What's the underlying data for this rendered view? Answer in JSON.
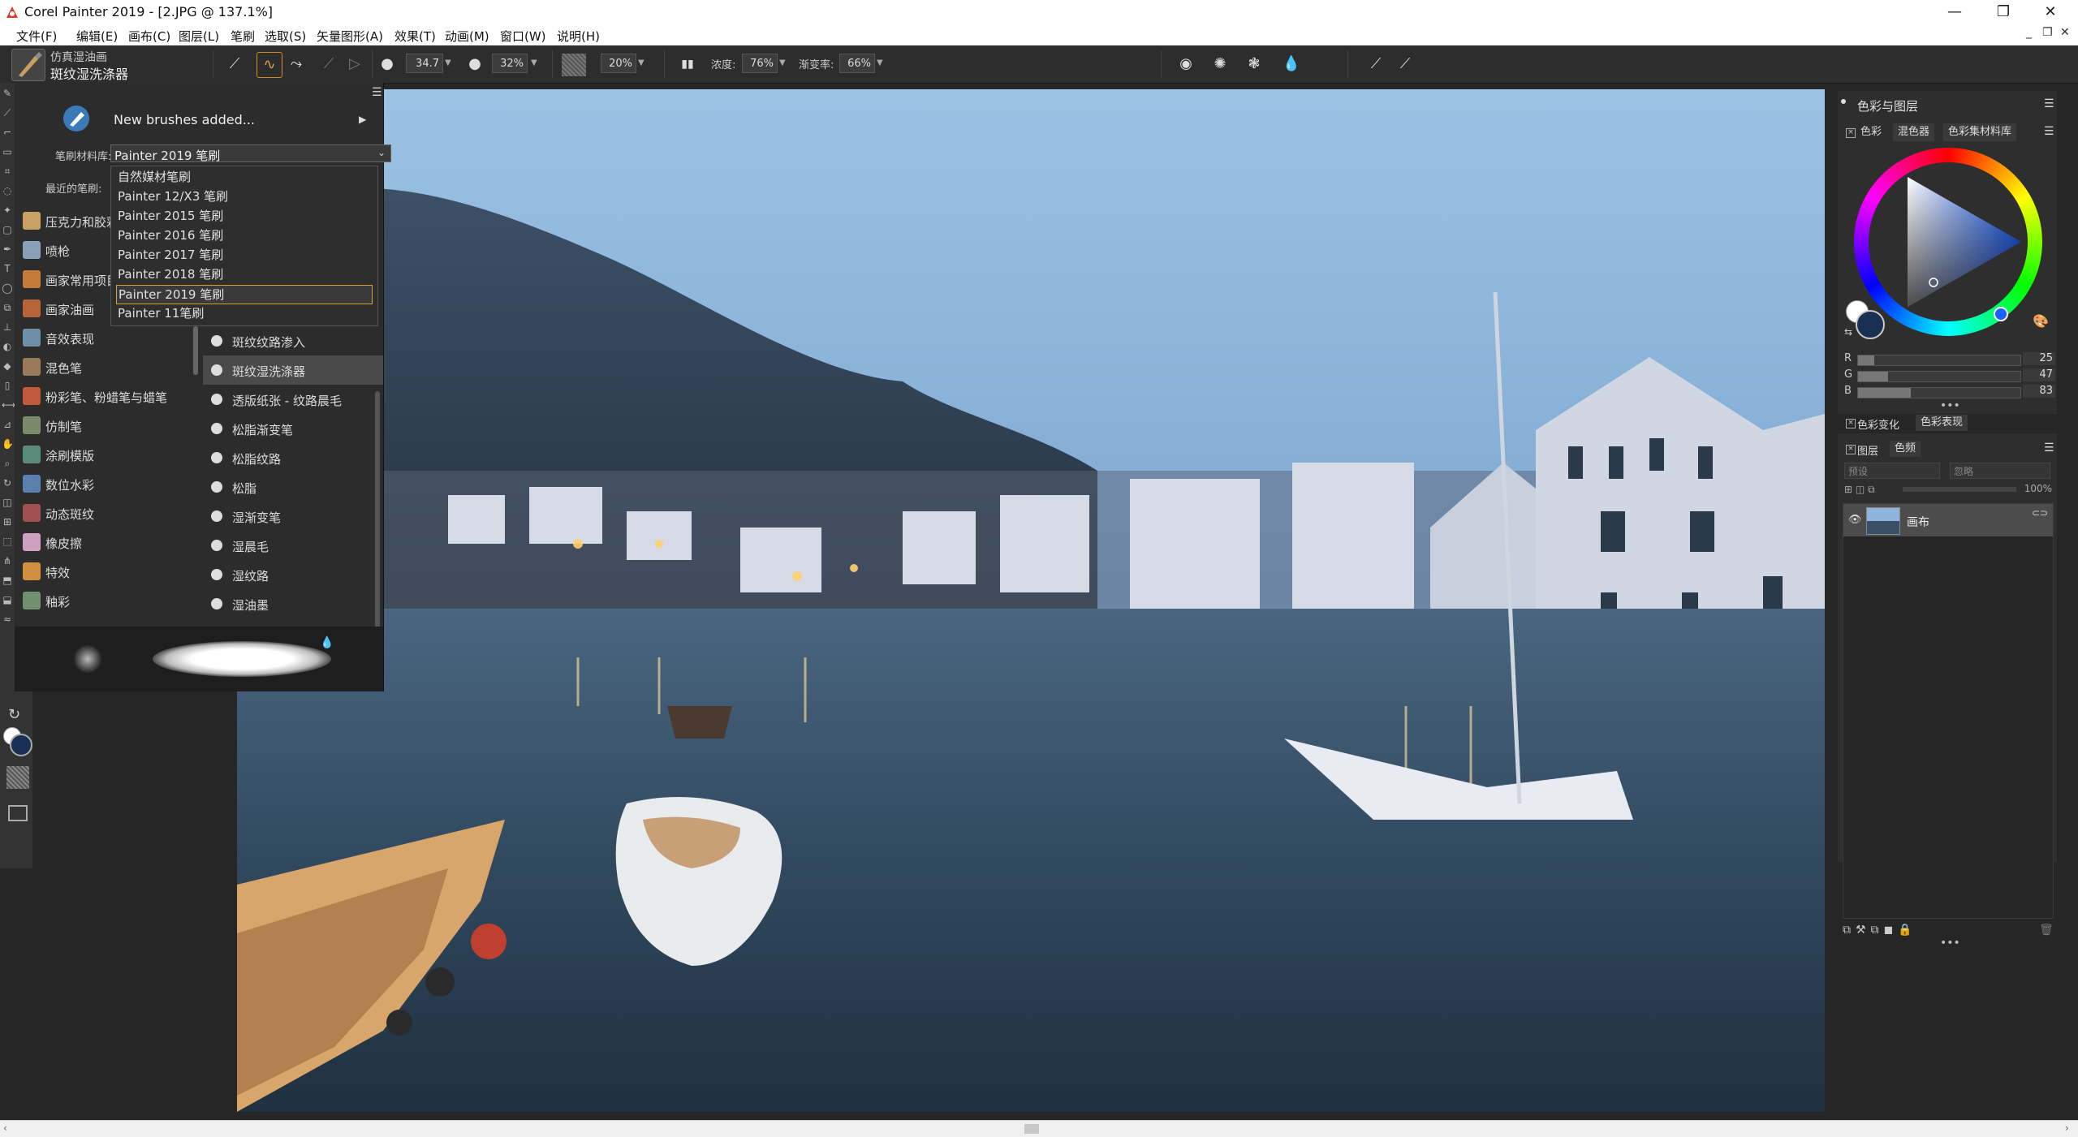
{
  "window": {
    "title": "Corel Painter 2019 - [2.JPG @ 137.1%]",
    "minimize": "—",
    "restore": "❐",
    "close": "✕",
    "mdi_min": "_",
    "mdi_restore": "❐",
    "mdi_close": "✕"
  },
  "menu": [
    "文件(F)",
    "编辑(E)",
    "画布(C)",
    "图层(L)",
    "笔刷",
    "选取(S)",
    "矢量图形(A)",
    "效果(T)",
    "动画(M)",
    "窗口(W)",
    "说明(H)"
  ],
  "brush": {
    "category": "仿真湿油画",
    "variant": "斑纹湿洗涤器"
  },
  "propbar": {
    "size_value": "34.7",
    "opacity_value": "32%",
    "grain_value": "20%",
    "density_label": "浓度:",
    "density_value": "76%",
    "blend_label": "渐变率:",
    "blend_value": "66%"
  },
  "brush_panel": {
    "new_brushes_text": "New brushes added...",
    "library_label": "笔刷材料库:",
    "library_value": "Painter 2019 笔刷",
    "recent_label": "最近的笔刷:",
    "library_options": [
      "自然媒材笔刷",
      "Painter 12/X3 笔刷",
      "Painter 2015 笔刷",
      "Painter 2016 笔刷",
      "Painter 2017 笔刷",
      "Painter 2018 笔刷",
      "Painter 2019 笔刷",
      "Painter 11笔刷"
    ],
    "selected_library_index": 6,
    "categories": [
      {
        "label": "压克力和胶彩",
        "color": "#c9a063"
      },
      {
        "label": "喷枪",
        "color": "#8aa0b8"
      },
      {
        "label": "画家常用项目",
        "color": "#c67a3a"
      },
      {
        "label": "画家油画",
        "color": "#b8643a"
      },
      {
        "label": "音效表现",
        "color": "#6e8fa8"
      },
      {
        "label": "混色笔",
        "color": "#9a7a5a"
      },
      {
        "label": "粉彩笔、粉蜡笔与蜡笔",
        "color": "#c05a3a"
      },
      {
        "label": "仿制笔",
        "color": "#7a8a6a"
      },
      {
        "label": "涂刷模版",
        "color": "#5a8a7a"
      },
      {
        "label": "数位水彩",
        "color": "#5a80b0"
      },
      {
        "label": "动态斑纹",
        "color": "#a05050"
      },
      {
        "label": "橡皮擦",
        "color": "#d0a0c0"
      },
      {
        "label": "特效",
        "color": "#d09040"
      },
      {
        "label": "釉彩",
        "color": "#709070"
      }
    ],
    "variants": [
      "斑纹纹路渗入",
      "斑纹湿洗涤器",
      "透版纸张 - 纹路晨毛",
      "松脂渐变笔",
      "松脂纹路",
      "松脂",
      "湿渐变笔",
      "湿晨毛",
      "湿纹路",
      "湿油墨"
    ],
    "selected_variant_index": 1
  },
  "right_panel": {
    "title": "色彩与图层",
    "tabs": [
      "色彩",
      "混色器",
      "色彩集材料库"
    ],
    "rgb": [
      {
        "label": "R",
        "value": "25",
        "fraction": 0.098
      },
      {
        "label": "G",
        "value": "47",
        "fraction": 0.184
      },
      {
        "label": "B",
        "value": "83",
        "fraction": 0.325
      }
    ],
    "color_tabs": [
      "色彩变化",
      "色彩表现"
    ],
    "layer_tabs": [
      "图层",
      "色频"
    ],
    "composite_method": "预设",
    "preserve_mode": "忽略",
    "opacity": "100%",
    "layers": [
      {
        "name": "画布"
      }
    ],
    "colors": {
      "main": "#192f53"
    }
  },
  "icons": {
    "app": "painter-logo-icon",
    "brush_sprayer": "new-brushes-icon",
    "drop": "drop-icon",
    "eye": "eye-icon",
    "lock": "lock-icon",
    "trash": "trash-icon",
    "hamburger": "menu-icon"
  }
}
